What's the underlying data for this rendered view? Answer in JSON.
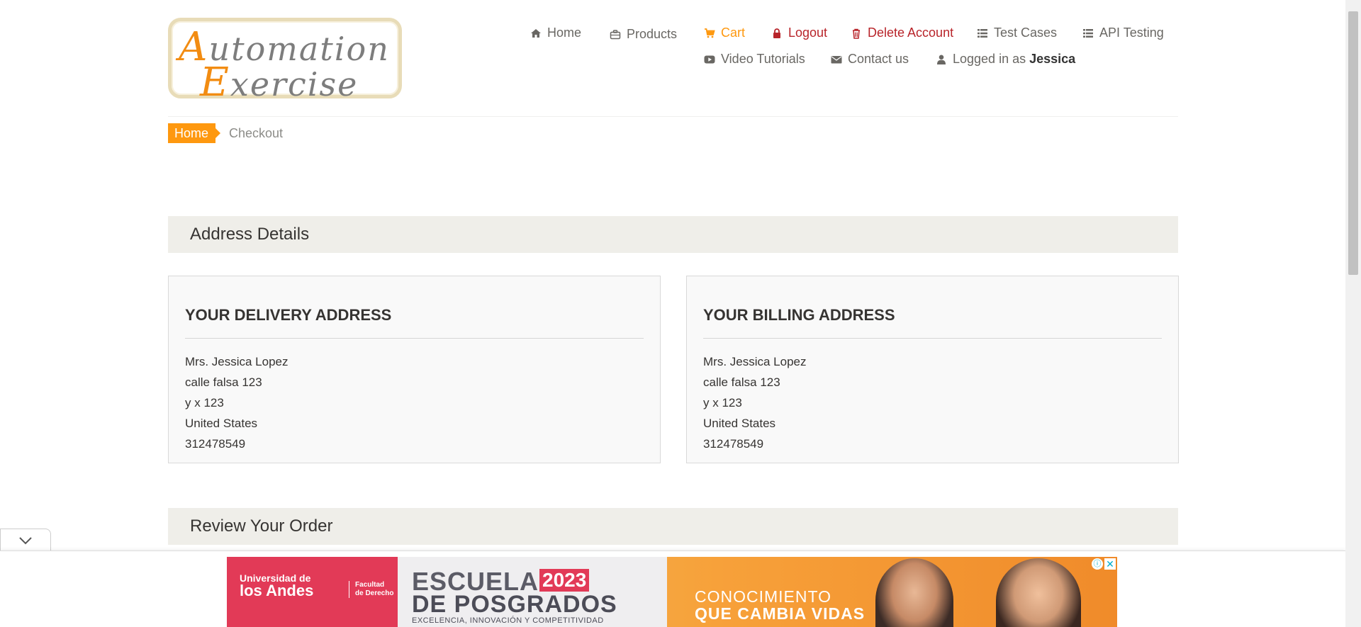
{
  "header": {
    "logo": {
      "line1_cap": "A",
      "line1_rest": "utomation",
      "line2_cap": "E",
      "line2_rest": "xercise"
    },
    "nav": {
      "home": "Home",
      "products": "Products",
      "cart": "Cart",
      "logout": "Logout",
      "delete_account": "Delete Account",
      "test_cases": "Test Cases",
      "api_testing": "API Testing",
      "video_tutorials": "Video Tutorials",
      "contact_us": "Contact us",
      "logged_in_prefix": "Logged in as",
      "logged_in_user": "Jessica"
    }
  },
  "breadcrumb": {
    "home": "Home",
    "current": "Checkout"
  },
  "address_section": {
    "title": "Address Details",
    "delivery": {
      "heading": "YOUR DELIVERY ADDRESS",
      "name": "Mrs. Jessica Lopez",
      "address1": "calle falsa 123",
      "address2": "y x 123",
      "country": "United States",
      "phone": "312478549"
    },
    "billing": {
      "heading": "YOUR BILLING ADDRESS",
      "name": "Mrs. Jessica Lopez",
      "address1": "calle falsa 123",
      "address2": "y x 123",
      "country": "United States",
      "phone": "312478549"
    }
  },
  "review_section": {
    "title": "Review Your Order"
  },
  "ad": {
    "university_line1": "Universidad de",
    "university_line2": "los Andes",
    "faculty_line1": "Facultad",
    "faculty_line2": "de Derecho",
    "school": "ESCUELA",
    "year": "2023",
    "postgrad": "DE POSGRADOS",
    "tagline": "EXCELENCIA, INNOVACIÓN Y COMPETITIVIDAD",
    "slogan_line1": "CONOCIMIENTO",
    "slogan_line2": "QUE CAMBIA VIDAS"
  },
  "colors": {
    "accent": "#fe980f",
    "danger": "#b8242a",
    "section_bg": "#efeee9",
    "ad_pink": "#e23a57"
  },
  "icons": [
    "home-icon",
    "briefcase-icon",
    "cart-icon",
    "lock-icon",
    "trash-icon",
    "list-icon",
    "video-icon",
    "envelope-icon",
    "user-icon",
    "chevron-down-icon",
    "ad-info-icon",
    "ad-close-icon"
  ]
}
